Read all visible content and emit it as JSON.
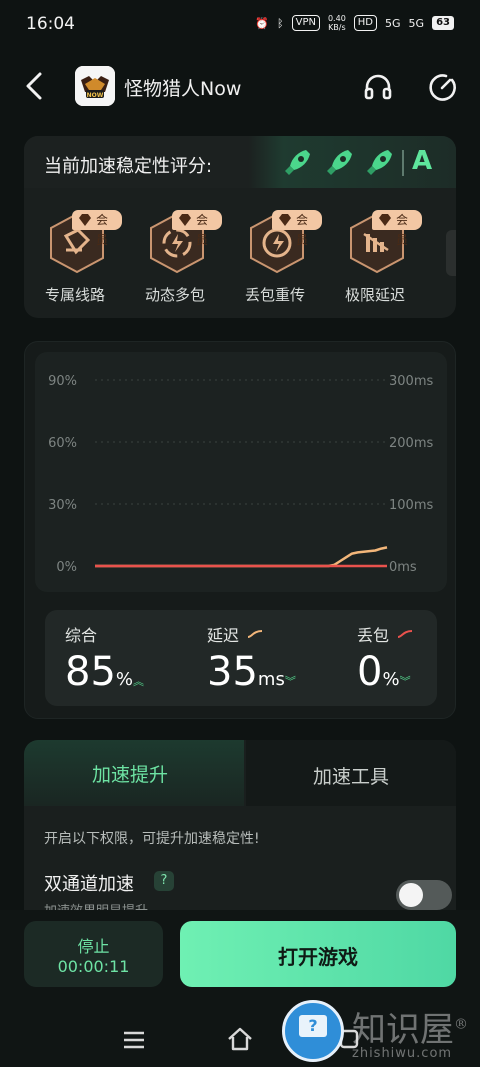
{
  "status_bar": {
    "time": "16:04",
    "vpn": "VPN",
    "speed": "0.40",
    "speed_unit": "KB/s",
    "hd": "HD",
    "net1": "5G",
    "net2": "5G",
    "battery": "63"
  },
  "header": {
    "title": "怪物猎人Now",
    "logo_text": "NOW"
  },
  "stability": {
    "label": "当前加速稳定性评分:",
    "grade": "A",
    "accent": "#5ee59c"
  },
  "features": [
    {
      "label": "专属线路",
      "badge": "会员",
      "icon": "route-icon"
    },
    {
      "label": "动态多包",
      "badge": "会员",
      "icon": "multi-packet-icon"
    },
    {
      "label": "丢包重传",
      "badge": "会员",
      "icon": "retransmit-icon"
    },
    {
      "label": "极限延迟",
      "badge": "会员",
      "icon": "latency-icon"
    }
  ],
  "chart_data": {
    "type": "line",
    "left_ticks": [
      "90%",
      "60%",
      "30%",
      "0%"
    ],
    "right_ticks": [
      "300ms",
      "200ms",
      "100ms",
      "0ms"
    ],
    "ylim_left": [
      0,
      90
    ],
    "ylim_right": [
      0,
      300
    ],
    "series": [
      {
        "name": "延迟",
        "axis": "right",
        "color": "#f2b67a",
        "values": [
          0,
          0,
          0,
          0,
          0,
          0,
          0,
          0,
          0,
          0,
          0,
          0,
          0,
          0,
          0,
          0,
          0,
          0,
          0,
          0,
          0,
          0,
          0,
          0,
          0,
          0,
          0,
          0,
          0,
          0,
          0,
          0,
          0,
          0,
          0,
          0,
          0,
          0,
          0,
          0,
          0,
          2,
          8,
          14,
          20,
          22,
          23,
          24,
          25,
          28,
          30
        ]
      },
      {
        "name": "丢包",
        "axis": "left",
        "color": "#e9524d",
        "values": [
          0,
          0,
          0,
          0,
          0,
          0,
          0,
          0,
          0,
          0,
          0,
          0,
          0,
          0,
          0,
          0,
          0,
          0,
          0,
          0,
          0,
          0,
          0,
          0,
          0,
          0,
          0,
          0,
          0,
          0,
          0,
          0,
          0,
          0,
          0,
          0,
          0,
          0,
          0,
          0,
          0,
          0,
          0,
          0,
          0,
          0,
          0,
          0,
          0,
          0,
          0
        ]
      }
    ]
  },
  "stats": {
    "overall": {
      "label": "综合",
      "value": "85",
      "unit": "%"
    },
    "latency": {
      "label": "延迟",
      "value": "35",
      "unit": "ms"
    },
    "loss": {
      "label": "丢包",
      "value": "0",
      "unit": "%"
    }
  },
  "tabs": {
    "active": "加速提升",
    "inactive": "加速工具",
    "hint": "开启以下权限，可提升加速稳定性!",
    "dual_title": "双通道加速",
    "dual_help": "?",
    "dual_sub": "加速效果明显提升",
    "toggle_on": false
  },
  "actions": {
    "stop_label": "停止",
    "stop_time": "00:00:11",
    "open_label": "打开游戏"
  },
  "watermark": {
    "text": "知识屋",
    "reg": "®",
    "sub": "zhishiwu.com",
    "badge": "?"
  }
}
